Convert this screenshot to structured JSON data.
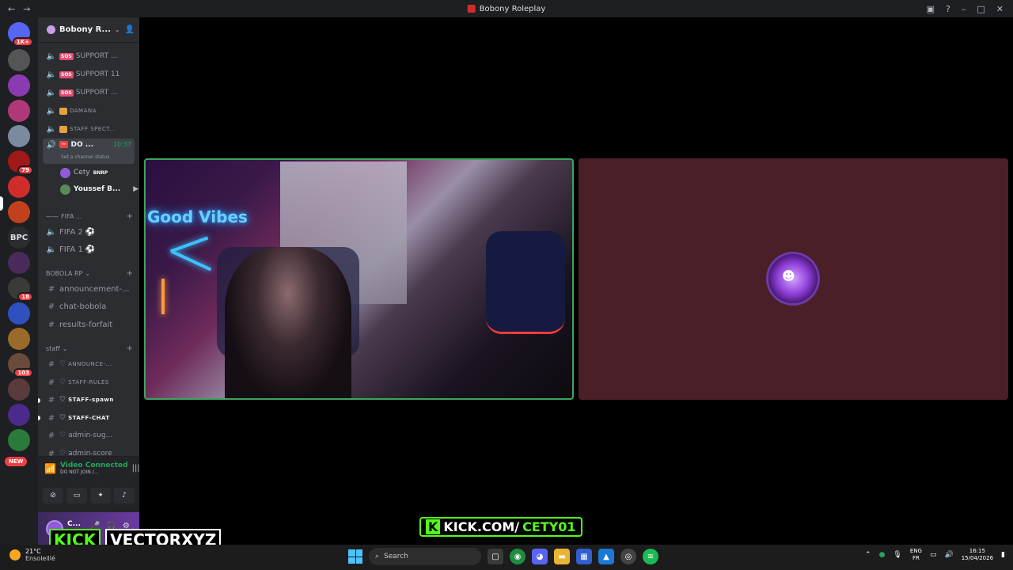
{
  "window": {
    "title": "Bobony Roleplay"
  },
  "guilds": {
    "home_badge": "1K+",
    "badges": [
      "79",
      "18",
      "103"
    ],
    "bpc_label": "BPC",
    "new_label": "NEW"
  },
  "server": {
    "name": "Bobony R..."
  },
  "channels": [
    {
      "label": "SUPPORT ...",
      "type": "voice",
      "tag": "SOS"
    },
    {
      "label": "SUPPORT 11",
      "type": "voice",
      "tag": "SOS"
    },
    {
      "label": "SUPPORT ...",
      "type": "voice",
      "tag": "SOS"
    },
    {
      "label": "DAMANA",
      "type": "voice",
      "tag": "gift"
    },
    {
      "label": "STAFF SPECT...",
      "type": "voice",
      "tag": "gift"
    },
    {
      "label": "DO ...",
      "type": "voice",
      "selected": true,
      "timer": "10:37",
      "status": "Set a channel status"
    }
  ],
  "voice_users": [
    {
      "name": "Cety",
      "brand": "BNRP"
    },
    {
      "name": "Youssef B..."
    }
  ],
  "fifa": {
    "category": "FIFA ...",
    "channels": [
      "FIFA 2",
      "FIFA 1"
    ]
  },
  "bobola": {
    "category": "BOBOLA RP",
    "channels": [
      "announcement-...",
      "chat-bobola",
      "results-forfait"
    ]
  },
  "staff": {
    "category": "staff",
    "channels": [
      "ANNOUNCE-...",
      "STAFF-RULES",
      "STAFF-spawn",
      "STAFF-CHAT",
      "admin-sug...",
      "admin-score"
    ]
  },
  "voice_connection": {
    "title": "Video Connected",
    "subtitle": "DO NOT JOIN /..."
  },
  "user": {
    "name": "C..."
  },
  "stream": {
    "neon_text": "Good Vibes",
    "kick_url_a": "KICK.COM/",
    "kick_url_b": "CETY01",
    "kick_k": "K",
    "kick_word": "KICK",
    "handle": "VECTORXYZ"
  },
  "taskbar": {
    "temp": "21°C",
    "weather": "Ensoleillé",
    "search_placeholder": "Search",
    "lang_1": "ENG",
    "lang_2": "FR",
    "time": "16:15",
    "date": "15/04/2026"
  },
  "colors": {
    "discord_bg": "#2b2d31",
    "accent_green": "#23a55a",
    "kick_green": "#53fc18",
    "avatar_tile": "#4a1f28"
  }
}
